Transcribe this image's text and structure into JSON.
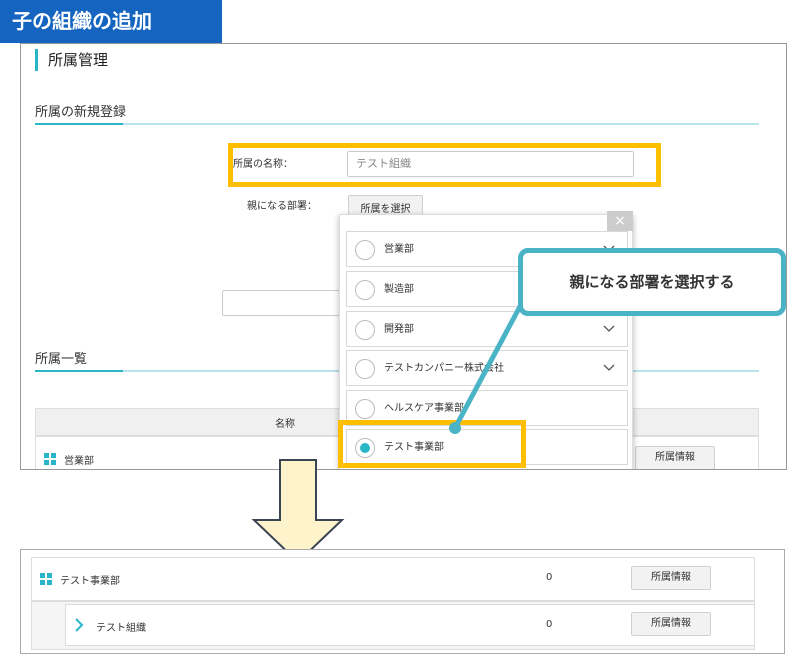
{
  "heading": "子の組織の追加",
  "page": {
    "title": "所属管理",
    "new_section": "所属の新規登録",
    "name_label": "所属の名称：",
    "name_value": "テスト組織",
    "parent_label": "親になる部署：",
    "select_button": "所属を選択",
    "list_section": "所属一覧",
    "col_name": "名称",
    "first_row": "営業部",
    "info_button": "所属情報"
  },
  "dropdown": {
    "close": "×",
    "items": [
      {
        "label": "営業部",
        "has_children": true,
        "selected": false
      },
      {
        "label": "製造部",
        "has_children": false,
        "selected": false
      },
      {
        "label": "開発部",
        "has_children": true,
        "selected": false
      },
      {
        "label": "テストカンパニー株式会社",
        "has_children": true,
        "selected": false
      },
      {
        "label": "ヘルスケア事業部",
        "has_children": false,
        "selected": false
      },
      {
        "label": "テスト事業部",
        "has_children": false,
        "selected": true
      }
    ]
  },
  "callout": "親になる部署を選択する",
  "result": {
    "row1_name": "テスト事業部",
    "row1_count": "0",
    "row1_button": "所属情報",
    "row2_name": "テスト組織",
    "row2_count": "0",
    "row2_button": "所属情報"
  },
  "colors": {
    "accent": "#29b6c8",
    "highlight": "#ffbf00",
    "label_bg": "#1565c0",
    "arrow_fill": "#fff3cc"
  }
}
